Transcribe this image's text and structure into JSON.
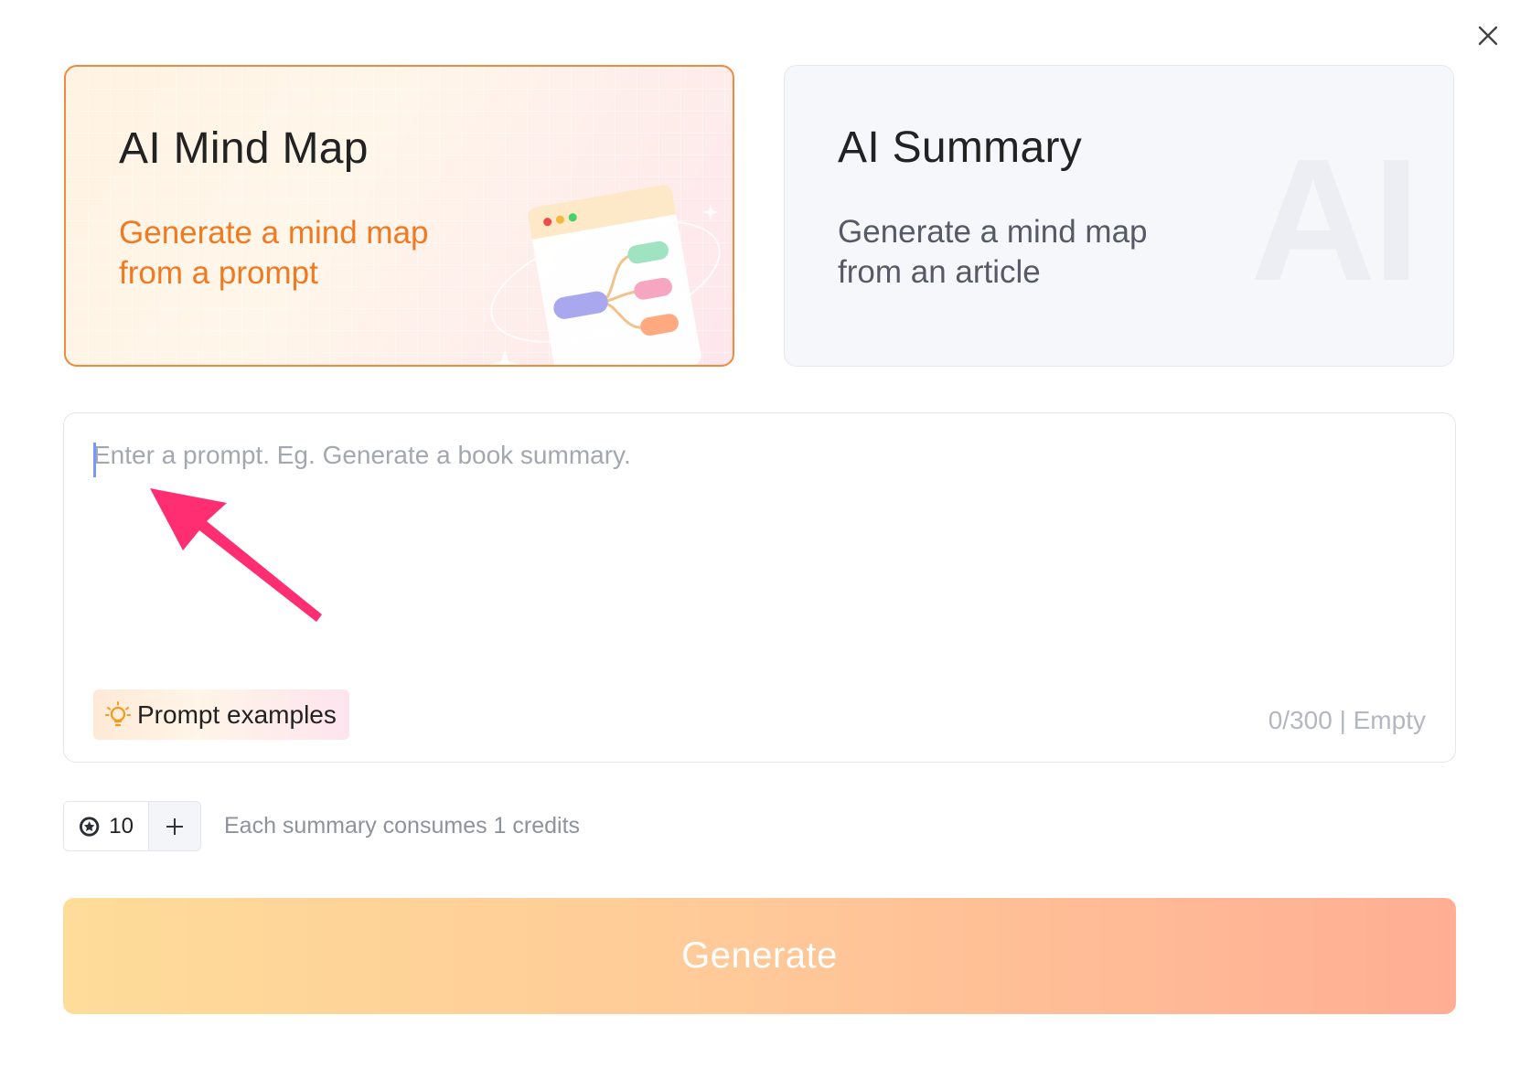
{
  "cards": {
    "mindmap": {
      "title": "AI Mind Map",
      "desc_line1": "Generate a mind map",
      "desc_line2": "from a prompt",
      "selected": true
    },
    "summary": {
      "title": "AI Summary",
      "desc_line1": "Generate a mind map",
      "desc_line2": "from an article",
      "watermark": "AI"
    }
  },
  "prompt": {
    "value": "",
    "placeholder": "Enter a prompt. Eg. Generate a book summary.",
    "examples_label": "Prompt examples",
    "counter": "0/300 | Empty"
  },
  "credits": {
    "count": "10",
    "note": "Each summary consumes 1 credits"
  },
  "generate": {
    "label": "Generate"
  },
  "colors": {
    "accent_orange": "#f07a22",
    "annotation_arrow": "#ff2e72",
    "generate_gradient_start": "#fedc99",
    "generate_gradient_end": "#ffae94"
  },
  "icons": {
    "close": "close-icon",
    "bulb": "lightbulb-icon",
    "coin": "credit-coin-icon",
    "plus": "plus-icon"
  }
}
